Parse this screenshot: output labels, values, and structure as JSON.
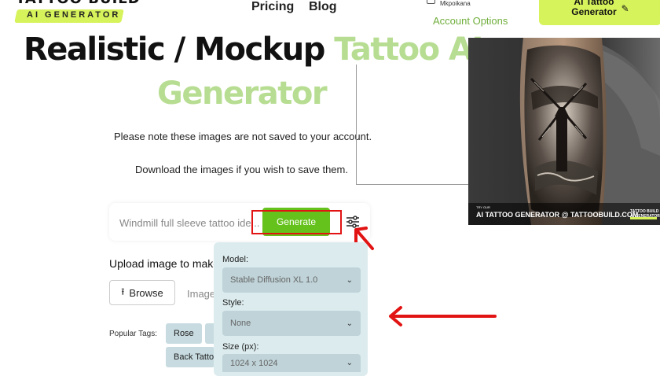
{
  "header": {
    "logo_title": "TATTOO BUILD",
    "logo_subtitle": "AI GENERATOR",
    "nav": [
      {
        "label": "Pricing"
      },
      {
        "label": "Blog"
      }
    ],
    "user_name": "Mkpoikana",
    "account_options": "Account Options",
    "cta_label": "AI Tattoo\nGenerator"
  },
  "hero": {
    "title_black": "Realistic / Mockup ",
    "title_green_1": "Tattoo AI",
    "title_green_2": "Generator",
    "note_1": "Please note these images are not saved to your account.",
    "note_2": "Download the images if you wish to save them."
  },
  "preview_image": {
    "caption_small": "TRY OUR",
    "caption": "AI TATTOO GENERATOR @ TATTOOBUILD.COM",
    "logo": "TATTOO BUILD\nAI GENERATOR"
  },
  "prompt": {
    "value": "Windmill full sleeve tattoo ide...",
    "generate_label": "Generate"
  },
  "upload": {
    "label": "Upload image to make",
    "browse_label": "Browse",
    "image_label": "Image",
    "popular_label": "Popular Tags:",
    "tags": [
      {
        "label": "Rose"
      },
      {
        "label": ""
      },
      {
        "label": "Back Tattoo"
      }
    ]
  },
  "settings": {
    "model_label": "Model:",
    "model_value": "Stable Diffusion XL 1.0",
    "style_label": "Style:",
    "style_value": "None",
    "size_label": "Size (px):",
    "size_value": "1024 x 1024"
  },
  "colors": {
    "accent_lime": "#d6f35b",
    "title_green": "#b7dd92",
    "generate_green": "#65c21c",
    "highlight_red": "#e21313",
    "panel_bg": "#dcebee"
  }
}
